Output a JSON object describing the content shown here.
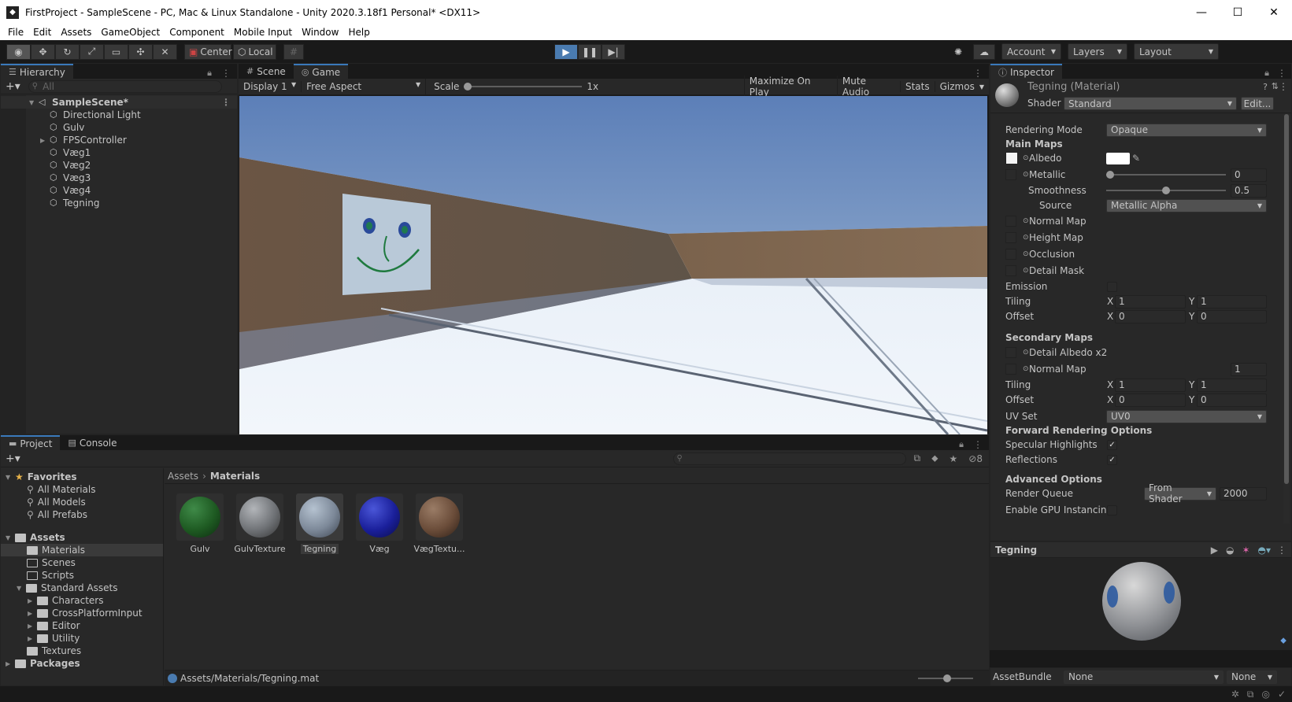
{
  "window": {
    "title": "FirstProject - SampleScene - PC, Mac & Linux Standalone - Unity 2020.3.18f1 Personal* <DX11>",
    "minimize": "—",
    "maximize": "☐",
    "close": "✕"
  },
  "menu": [
    "File",
    "Edit",
    "Assets",
    "GameObject",
    "Component",
    "Mobile Input",
    "Window",
    "Help"
  ],
  "toolbar": {
    "pivot": "Center",
    "space": "Local",
    "account": "Account",
    "layers": "Layers",
    "layout": "Layout"
  },
  "hierarchy": {
    "tab": "Hierarchy",
    "search_placeholder": "All",
    "scene": "SampleScene*",
    "items": [
      "Directional Light",
      "Gulv",
      "FPSController",
      "Væg1",
      "Væg2",
      "Væg3",
      "Væg4",
      "Tegning"
    ]
  },
  "game": {
    "tabs": [
      "Scene",
      "Game"
    ],
    "display": "Display 1",
    "aspect": "Free Aspect",
    "scale_label": "Scale",
    "scale_value": "1x",
    "maximize": "Maximize On Play",
    "mute": "Mute Audio",
    "stats": "Stats",
    "gizmos": "Gizmos"
  },
  "project": {
    "tabs": [
      "Project",
      "Console"
    ],
    "badge_count": "8",
    "favorites": "Favorites",
    "fav_items": [
      "All Materials",
      "All Models",
      "All Prefabs"
    ],
    "assets": "Assets",
    "asset_folders": [
      "Materials",
      "Scenes",
      "Scripts"
    ],
    "standard_assets": "Standard Assets",
    "standard_children": [
      "Characters",
      "CrossPlatformInput",
      "Editor",
      "Utility"
    ],
    "textures": "Textures",
    "packages": "Packages",
    "breadcrumb_root": "Assets",
    "breadcrumb_current": "Materials",
    "grid": [
      {
        "label": "Gulv",
        "color": "#1e5a22"
      },
      {
        "label": "GulvTexture",
        "color": "#6f7276"
      },
      {
        "label": "Tegning",
        "color": "#7c8898"
      },
      {
        "label": "Væg",
        "color": "#1a1f9a"
      },
      {
        "label": "VægTextu...",
        "color": "#6a4c39"
      }
    ],
    "path": "Assets/Materials/Tegning.mat"
  },
  "inspector": {
    "tab": "Inspector",
    "material_name": "Tegning (Material)",
    "shader_label": "Shader",
    "shader_value": "Standard",
    "edit": "Edit...",
    "rendering_mode_label": "Rendering Mode",
    "rendering_mode_value": "Opaque",
    "main_maps": "Main Maps",
    "albedo": "Albedo",
    "metallic": "Metallic",
    "metallic_value": "0",
    "smoothness": "Smoothness",
    "smoothness_value": "0.5",
    "source": "Source",
    "source_value": "Metallic Alpha",
    "normal_map": "Normal Map",
    "height_map": "Height Map",
    "occlusion": "Occlusion",
    "detail_mask": "Detail Mask",
    "emission": "Emission",
    "tiling": "Tiling",
    "offset": "Offset",
    "x": "X",
    "y": "Y",
    "tiling_x": "1",
    "tiling_y": "1",
    "offset_x": "0",
    "offset_y": "0",
    "secondary_maps": "Secondary Maps",
    "detail_albedo": "Detail Albedo x2",
    "normal_map2": "Normal Map",
    "normal_map2_value": "1",
    "tiling2_x": "1",
    "tiling2_y": "1",
    "offset2_x": "0",
    "offset2_y": "0",
    "uv_set": "UV Set",
    "uv_set_value": "UV0",
    "forward": "Forward Rendering Options",
    "specular": "Specular Highlights",
    "reflections": "Reflections",
    "advanced": "Advanced Options",
    "render_queue": "Render Queue",
    "render_queue_mode": "From Shader",
    "render_queue_value": "2000",
    "gpu_instancing": "Enable GPU Instancing",
    "preview_name": "Tegning",
    "assetbundle_label": "AssetBundle",
    "assetbundle_value": "None",
    "assetbundle_variant": "None"
  }
}
